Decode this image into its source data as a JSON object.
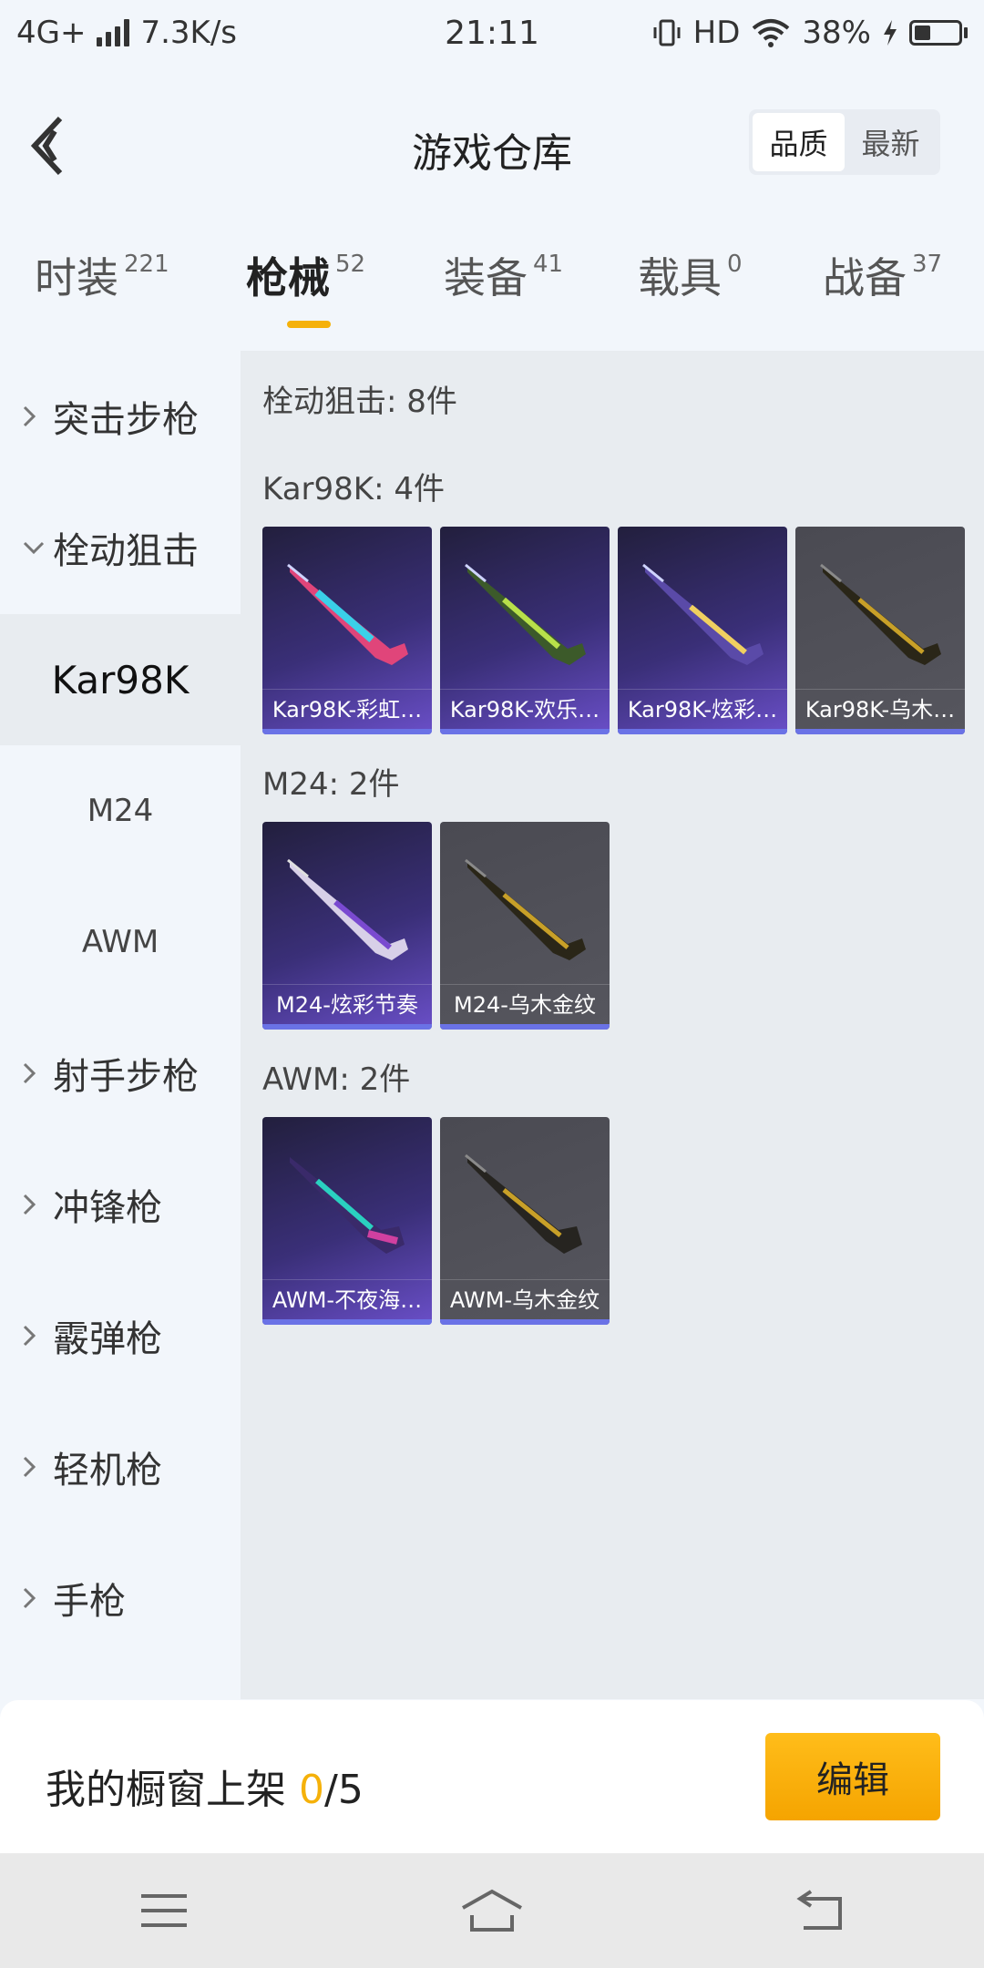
{
  "status_bar": {
    "network": "4G+",
    "speed": "7.3K/s",
    "time": "21:11",
    "hd": "HD",
    "battery": "38%"
  },
  "header": {
    "title": "游戏仓库",
    "sort_options": [
      "品质",
      "最新"
    ],
    "sort_active": "品质"
  },
  "category_tabs": [
    {
      "name": "时装",
      "count": "221"
    },
    {
      "name": "枪械",
      "count": "52",
      "active": true
    },
    {
      "name": "装备",
      "count": "41"
    },
    {
      "name": "载具",
      "count": "0"
    },
    {
      "name": "战备",
      "count": "37"
    }
  ],
  "sidebar": {
    "items": [
      {
        "label": "突击步枪",
        "type": "group",
        "expanded": false
      },
      {
        "label": "栓动狙击",
        "type": "group",
        "expanded": true
      },
      {
        "label": "Kar98K",
        "type": "sub",
        "selected": true
      },
      {
        "label": "M24",
        "type": "sub"
      },
      {
        "label": "AWM",
        "type": "sub"
      },
      {
        "label": "射手步枪",
        "type": "group",
        "expanded": false
      },
      {
        "label": "冲锋枪",
        "type": "group",
        "expanded": false
      },
      {
        "label": "霰弹枪",
        "type": "group",
        "expanded": false
      },
      {
        "label": "轻机枪",
        "type": "group",
        "expanded": false
      },
      {
        "label": "手枪",
        "type": "group",
        "expanded": false
      }
    ]
  },
  "content": {
    "category_summary": "栓动狙击: 8件",
    "sections": [
      {
        "title": "Kar98K: 4件",
        "items": [
          {
            "name": "Kar98K-彩虹…",
            "rarity": "purple"
          },
          {
            "name": "Kar98K-欢乐…",
            "rarity": "purple"
          },
          {
            "name": "Kar98K-炫彩…",
            "rarity": "purple"
          },
          {
            "name": "Kar98K-乌木…",
            "rarity": "gray"
          }
        ]
      },
      {
        "title": "M24: 2件",
        "items": [
          {
            "name": "M24-炫彩节奏",
            "rarity": "purple"
          },
          {
            "name": "M24-乌木金纹",
            "rarity": "gray"
          }
        ]
      },
      {
        "title": "AWM: 2件",
        "items": [
          {
            "name": "AWM-不夜海…",
            "rarity": "purple"
          },
          {
            "name": "AWM-乌木金纹",
            "rarity": "gray"
          }
        ]
      }
    ]
  },
  "showcase": {
    "label": "我的橱窗上架 ",
    "current": "0",
    "total": "/5",
    "edit_label": "编辑"
  },
  "colors": {
    "accent": "#f5b10a",
    "rarity_purple": "#6a72e6"
  }
}
